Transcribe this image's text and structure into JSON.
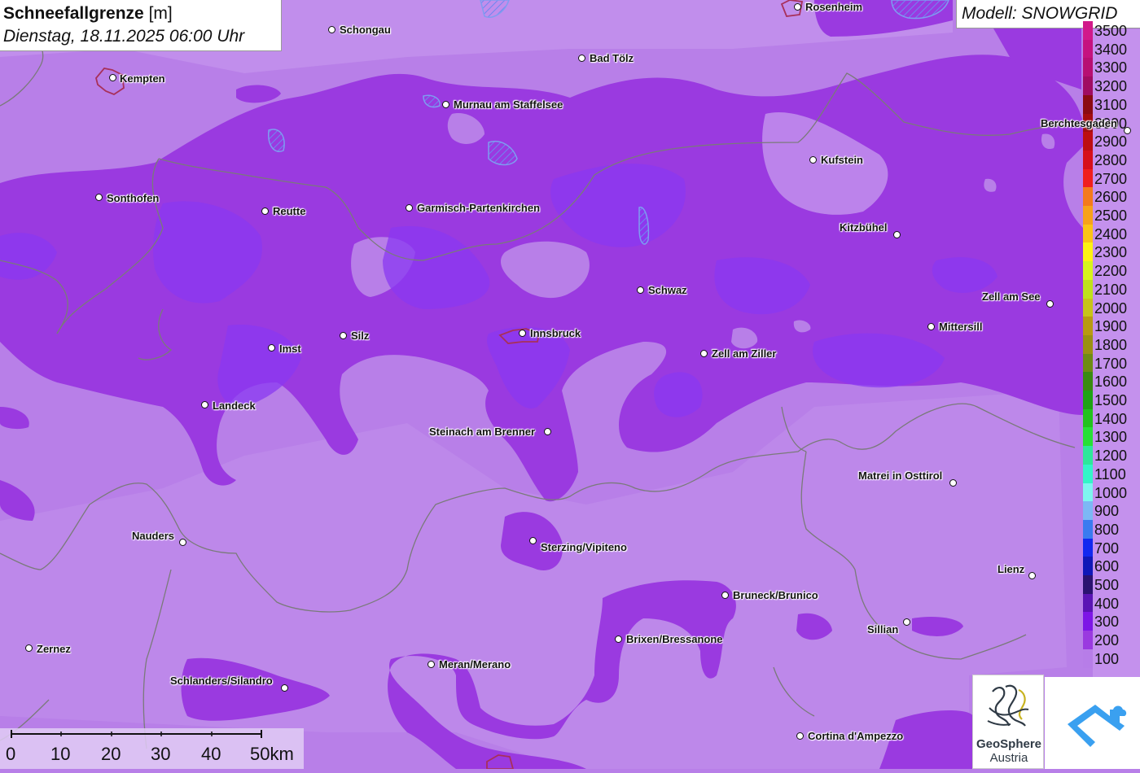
{
  "header": {
    "title": "Schneefallgrenze",
    "unit": "[m]",
    "datetime": "Dienstag, 18.11.2025 06:00 Uhr",
    "model": "Modell: SNOWGRID"
  },
  "legend": {
    "items": [
      {
        "label": "3500",
        "color": "#d11a8a"
      },
      {
        "label": "3400",
        "color": "#c5127f"
      },
      {
        "label": "3300",
        "color": "#b70f72"
      },
      {
        "label": "3200",
        "color": "#a00c62"
      },
      {
        "label": "3100",
        "color": "#8b0b12"
      },
      {
        "label": "3000",
        "color": "#a30d10"
      },
      {
        "label": "2900",
        "color": "#bd0e12"
      },
      {
        "label": "2800",
        "color": "#d6101a"
      },
      {
        "label": "2700",
        "color": "#f01e1e"
      },
      {
        "label": "2600",
        "color": "#f47a1c"
      },
      {
        "label": "2500",
        "color": "#f7a21a"
      },
      {
        "label": "2400",
        "color": "#fbc416"
      },
      {
        "label": "2300",
        "color": "#fdf213"
      },
      {
        "label": "2200",
        "color": "#d7f51c"
      },
      {
        "label": "2100",
        "color": "#bfe21c"
      },
      {
        "label": "2000",
        "color": "#c7c41a"
      },
      {
        "label": "1900",
        "color": "#b89a12"
      },
      {
        "label": "1800",
        "color": "#9a9012"
      },
      {
        "label": "1700",
        "color": "#6e8b14"
      },
      {
        "label": "1600",
        "color": "#3a8a12"
      },
      {
        "label": "1500",
        "color": "#1ea214"
      },
      {
        "label": "1400",
        "color": "#22c21e"
      },
      {
        "label": "1300",
        "color": "#27e036"
      },
      {
        "label": "1200",
        "color": "#2de89a"
      },
      {
        "label": "1100",
        "color": "#33f5c8"
      },
      {
        "label": "1000",
        "color": "#7ff5f0"
      },
      {
        "label": "900",
        "color": "#7cb8f5"
      },
      {
        "label": "800",
        "color": "#3a7bf0"
      },
      {
        "label": "700",
        "color": "#1228f0"
      },
      {
        "label": "600",
        "color": "#1018b8"
      },
      {
        "label": "500",
        "color": "#2a1370"
      },
      {
        "label": "400",
        "color": "#5a14b4"
      },
      {
        "label": "300",
        "color": "#7d16e6"
      },
      {
        "label": "200",
        "color": "#9a3ae0"
      },
      {
        "label": "100",
        "color": "#b77de8"
      }
    ]
  },
  "cities": [
    {
      "name": "Schongau",
      "dot": [
        408,
        37
      ],
      "label": [
        417,
        30
      ],
      "side": "right"
    },
    {
      "name": "Rosenheim",
      "dot": [
        980,
        9
      ],
      "label": [
        989,
        2
      ],
      "side": "right"
    },
    {
      "name": "Kempten",
      "dot": [
        139,
        96
      ],
      "label": [
        147,
        90
      ],
      "side": "right"
    },
    {
      "name": "Bad Tölz",
      "dot": [
        715,
        72
      ],
      "label": [
        724,
        65
      ],
      "side": "right"
    },
    {
      "name": "Murnau am Staffelsee",
      "dot": [
        548,
        129
      ],
      "label": [
        557,
        122
      ],
      "side": "right"
    },
    {
      "name": "Berchtesgaden",
      "dot": [
        1385,
        161
      ],
      "label": [
        1278,
        145
      ],
      "side": "left"
    },
    {
      "name": "Kufstein",
      "dot": [
        999,
        197
      ],
      "label": [
        1008,
        190
      ],
      "side": "right"
    },
    {
      "name": "Sonthofen",
      "dot": [
        122,
        243
      ],
      "label": [
        131,
        237
      ],
      "side": "right"
    },
    {
      "name": "Reutte",
      "dot": [
        326,
        260
      ],
      "label": [
        335,
        253
      ],
      "side": "right"
    },
    {
      "name": "Garmisch-Partenkirchen",
      "dot": [
        503,
        256
      ],
      "label": [
        512,
        249
      ],
      "side": "right"
    },
    {
      "name": "Kitzbühel",
      "dot": [
        1102,
        289
      ],
      "label": [
        1031,
        273
      ],
      "side": "left"
    },
    {
      "name": "Schwaz",
      "dot": [
        787,
        357
      ],
      "label": [
        796,
        350
      ],
      "side": "right"
    },
    {
      "name": "Zell am See",
      "dot": [
        1290,
        374
      ],
      "label": [
        1206,
        358
      ],
      "side": "left"
    },
    {
      "name": "Mittersill",
      "dot": [
        1144,
        402
      ],
      "label": [
        1153,
        395
      ],
      "side": "right"
    },
    {
      "name": "Silz",
      "dot": [
        422,
        413
      ],
      "label": [
        431,
        406
      ],
      "side": "right"
    },
    {
      "name": "Innsbruck",
      "dot": [
        642,
        410
      ],
      "label": [
        651,
        403
      ],
      "side": "right"
    },
    {
      "name": "Imst",
      "dot": [
        334,
        428
      ],
      "label": [
        343,
        422
      ],
      "side": "right"
    },
    {
      "name": "Zell am Ziller",
      "dot": [
        865,
        435
      ],
      "label": [
        874,
        428
      ],
      "side": "right"
    },
    {
      "name": "Landeck",
      "dot": [
        252,
        498
      ],
      "label": [
        261,
        492
      ],
      "side": "right"
    },
    {
      "name": "Steinach am Brenner",
      "dot": [
        673,
        531
      ],
      "label": [
        527,
        524
      ],
      "side": "left"
    },
    {
      "name": "Matrei in Osttirol",
      "dot": [
        1171,
        594
      ],
      "label": [
        1054,
        578
      ],
      "side": "left"
    },
    {
      "name": "Nauders",
      "dot": [
        225,
        667
      ],
      "label": [
        162,
        652
      ],
      "side": "left"
    },
    {
      "name": "Sterzing/Vipiteno",
      "dot": [
        655,
        665
      ],
      "label": [
        664,
        666
      ],
      "side": "right"
    },
    {
      "name": "Lienz",
      "dot": [
        1268,
        708
      ],
      "label": [
        1225,
        693
      ],
      "side": "left"
    },
    {
      "name": "Bruneck/Brunico",
      "dot": [
        891,
        732
      ],
      "label": [
        900,
        725
      ],
      "side": "right"
    },
    {
      "name": "Sillian",
      "dot": [
        1114,
        765
      ],
      "label": [
        1065,
        767
      ],
      "side": "left"
    },
    {
      "name": "Brixen/Bressanone",
      "dot": [
        760,
        786
      ],
      "label": [
        769,
        779
      ],
      "side": "right"
    },
    {
      "name": "Zernez",
      "dot": [
        36,
        797
      ],
      "label": [
        45,
        791
      ],
      "side": "right"
    },
    {
      "name": "Meran/Merano",
      "dot": [
        530,
        817
      ],
      "label": [
        539,
        810
      ],
      "side": "right"
    },
    {
      "name": "Schlanders/Silandro",
      "dot": [
        350,
        846
      ],
      "label": [
        209,
        830
      ],
      "side": "left"
    },
    {
      "name": "Cortina d'Ampezzo",
      "dot": [
        983,
        905
      ],
      "label": [
        992,
        898
      ],
      "side": "right"
    }
  ],
  "scale": {
    "labels": [
      "0",
      "10",
      "20",
      "30",
      "40",
      "50km"
    ]
  },
  "logos": {
    "geosphere_line1": "GeoSphere",
    "geosphere_line2": "Austria"
  },
  "colors": {
    "base": "#b87fe8",
    "band_200": "#9a3ae0",
    "band_300": "#8a2ef0",
    "border": "#7a7a7a",
    "lake": "#8c9cf0"
  }
}
